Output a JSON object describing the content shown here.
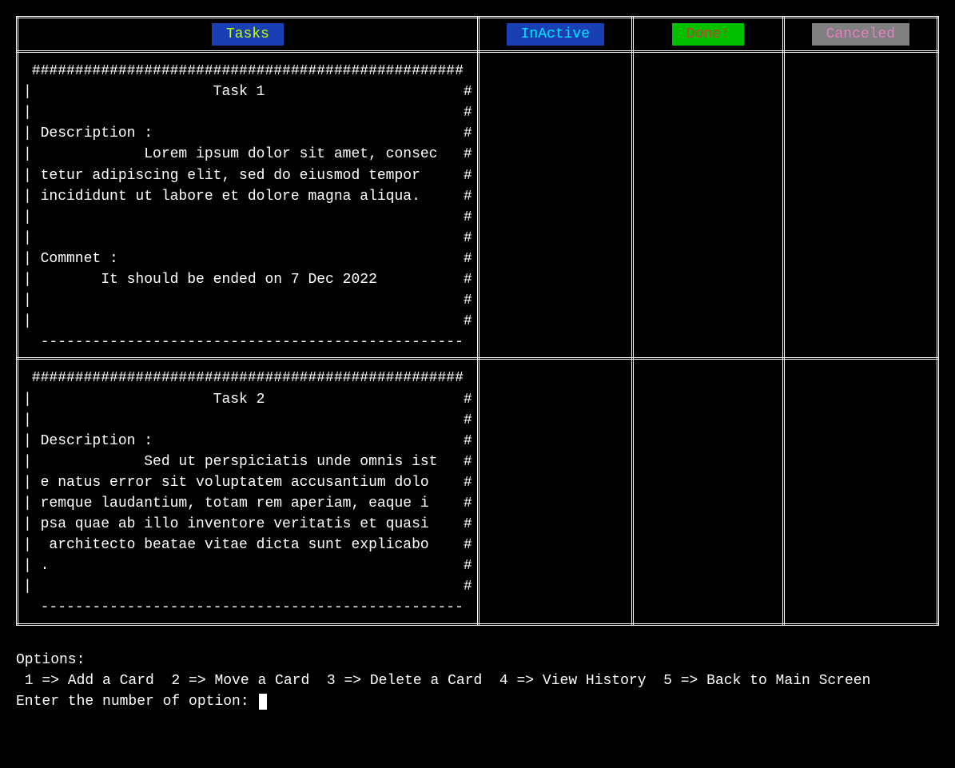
{
  "columns": {
    "tasks": "Tasks",
    "inactive": "InActive",
    "done": "Done!",
    "canceled": "Canceled"
  },
  "cards": [
    {
      "ascii": " ##################################################\n|                     Task 1                       #\n|                                                  #\n| Description :                                    #\n|             Lorem ipsum dolor sit amet, consec   #\n| tetur adipiscing elit, sed do eiusmod tempor     #\n| incididunt ut labore et dolore magna aliqua.     #\n|                                                  #\n|                                                  #\n| Commnet :                                        #\n|        It should be ended on 7 Dec 2022          #\n|                                                  #\n|                                                  #\n  -------------------------------------------------"
    },
    {
      "ascii": " ##################################################\n|                     Task 2                       #\n|                                                  #\n| Description :                                    #\n|             Sed ut perspiciatis unde omnis ist   #\n| e natus error sit voluptatem accusantium dolo    #\n| remque laudantium, totam rem aperiam, eaque i    #\n| psa quae ab illo inventore veritatis et quasi    #\n|  architecto beatae vitae dicta sunt explicabo    #\n| .                                                #\n|                                                  #\n  -------------------------------------------------"
    }
  ],
  "options": {
    "title": "Options:",
    "line": " 1 => Add a Card  2 => Move a Card  3 => Delete a Card  4 => View History  5 => Back to Main Screen",
    "prompt": "Enter the number of option: "
  }
}
